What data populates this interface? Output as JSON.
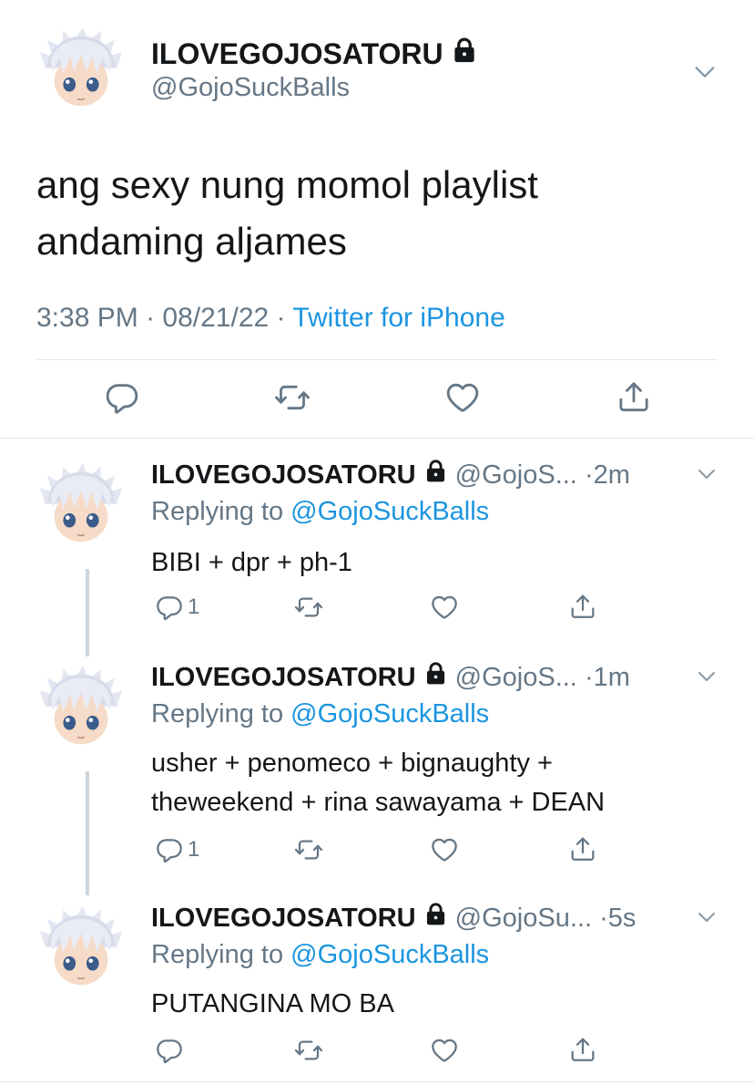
{
  "main_tweet": {
    "display_name": "ILOVEGOJOSATORU",
    "handle": "@GojoSuckBalls",
    "text_line1": "ang sexy nung momol playlist",
    "text_line2": "andaming aljames",
    "time": "3:38 PM",
    "sep1": "·",
    "date": "08/21/22",
    "sep2": "·",
    "source": "Twitter for iPhone"
  },
  "replies": [
    {
      "display_name": "ILOVEGOJOSATORU",
      "handle": "@GojoS...",
      "time": "·2m",
      "replying_prefix": "Replying to",
      "replying_handle": "@GojoSuckBalls",
      "text_line1": "BIBI + dpr + ph-1",
      "text_line2": "",
      "reply_count": "1"
    },
    {
      "display_name": "ILOVEGOJOSATORU",
      "handle": "@GojoS...",
      "time": "·1m",
      "replying_prefix": "Replying to",
      "replying_handle": "@GojoSuckBalls",
      "text_line1": "usher + penomeco + bignaughty +",
      "text_line2": "theweekend + rina sawayama + DEAN",
      "reply_count": "1"
    },
    {
      "display_name": "ILOVEGOJOSATORU",
      "handle": "@GojoSu...",
      "time": "·5s",
      "replying_prefix": "Replying to",
      "replying_handle": "@GojoSuckBalls",
      "text_line1": "PUTANGINA MO BA",
      "text_line2": "",
      "reply_count": ""
    }
  ],
  "icons": {
    "reply": "reply-icon",
    "retweet": "retweet-icon",
    "like": "heart-icon",
    "share": "share-icon",
    "lock": "lock-icon",
    "caret": "chevron-down-icon"
  },
  "colors": {
    "link": "#1b95e0",
    "muted": "#657786",
    "text": "#14171a",
    "divider": "#e1e8ed",
    "thread_line": "#ccd6dd"
  }
}
